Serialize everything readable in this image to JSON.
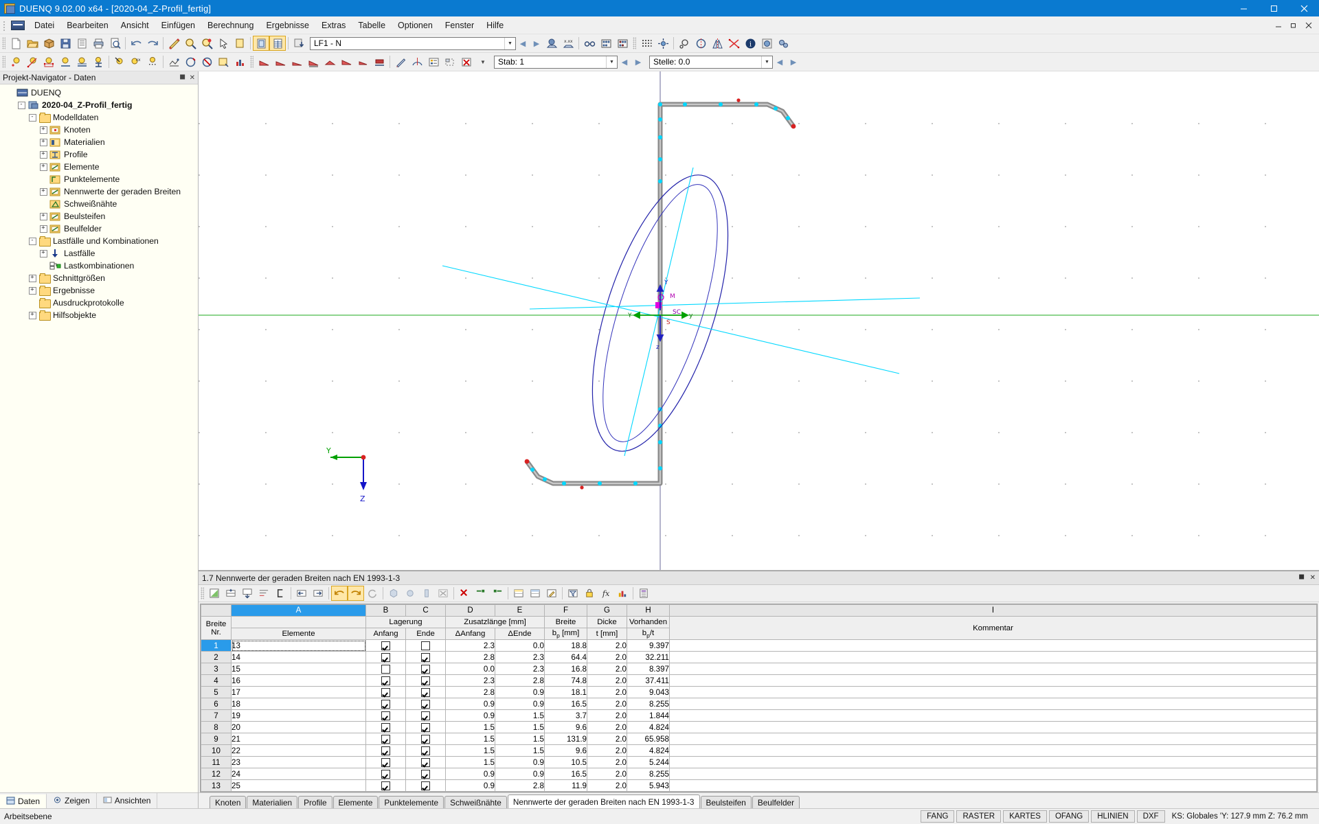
{
  "window": {
    "title": "DUENQ 9.02.00 x64 - [2020-04_Z-Profil_fertig]",
    "minimize": "–",
    "maximize": "❐",
    "close": "✕",
    "mdi_minimize": "–",
    "mdi_restore": "❐",
    "mdi_close": "✕"
  },
  "menubar": {
    "items": [
      {
        "label": "Datei"
      },
      {
        "label": "Bearbeiten"
      },
      {
        "label": "Ansicht"
      },
      {
        "label": "Einfügen"
      },
      {
        "label": "Berechnung"
      },
      {
        "label": "Ergebnisse"
      },
      {
        "label": "Extras"
      },
      {
        "label": "Tabelle"
      },
      {
        "label": "Optionen"
      },
      {
        "label": "Fenster"
      },
      {
        "label": "Hilfe"
      }
    ]
  },
  "toolbar1": {
    "loadcase_value": "LF1 - N",
    "icons": [
      "new-file-icon",
      "open-folder-icon",
      "package-icon",
      "save-icon",
      "clipboard-icon",
      "print-icon",
      "print-preview-icon",
      "undo-icon",
      "redo-icon",
      "edit-section-icon",
      "zoom-icon",
      "zoom-warning-icon",
      "select-pointer-icon",
      "copy-icon",
      "render-panel-icon",
      "table-panel-icon",
      "export-icon"
    ],
    "nav_prev": "◀",
    "nav_next": "▶",
    "icons2": [
      "view-point-icon",
      "scale-xx-icon",
      "glasses-icon",
      "abacus-icon",
      "abacus2-icon",
      "grid-icon",
      "snap-icon",
      "rotate-icon",
      "mirror-icon",
      "symmetry-icon",
      "intersect-icon",
      "info-icon",
      "settings-icon",
      "gears-icon"
    ]
  },
  "toolbar2": {
    "stab_label": "Stab: 1",
    "stelle_label": "Stelle: 0.0",
    "nav_prev": "◀",
    "nav_next": "▶",
    "icons": [
      "node-icon",
      "line-icon",
      "member-icon",
      "support-icon",
      "support2-icon",
      "section-icon",
      "load-icon",
      "load-xx-icon",
      "load-dist-icon",
      "mesh-icon",
      "rotate-red-icon",
      "cancel-icon",
      "panel-icon",
      "chart-icon",
      "arrow1-icon",
      "arrow2-icon",
      "arrow3-icon",
      "arrow4-icon",
      "arrow5-icon",
      "arrow6-icon",
      "arrow7-icon",
      "block-icon",
      "pen-icon",
      "compass-icon",
      "legend-icon",
      "frame-icon",
      "clear-x-icon"
    ]
  },
  "navigator": {
    "header": "Projekt-Navigator - Daten",
    "pin_icon": "❐",
    "close_icon": "✕",
    "tree": [
      {
        "label": "DUENQ",
        "indent": 0,
        "expander": "",
        "icon": "app-icon",
        "bold": false
      },
      {
        "label": "2020-04_Z-Profil_fertig",
        "indent": 1,
        "expander": "-",
        "icon": "model-icon",
        "bold": true
      },
      {
        "label": "Modelldaten",
        "indent": 2,
        "expander": "-",
        "icon": "folder-icon",
        "bold": false
      },
      {
        "label": "Knoten",
        "indent": 3,
        "expander": "+",
        "icon": "node-folder-icon",
        "bold": false
      },
      {
        "label": "Materialien",
        "indent": 3,
        "expander": "+",
        "icon": "material-folder-icon",
        "bold": false
      },
      {
        "label": "Profile",
        "indent": 3,
        "expander": "+",
        "icon": "profile-folder-icon",
        "bold": false
      },
      {
        "label": "Elemente",
        "indent": 3,
        "expander": "+",
        "icon": "element-folder-icon",
        "bold": false
      },
      {
        "label": "Punktelemente",
        "indent": 3,
        "expander": "",
        "icon": "point-folder-icon",
        "bold": false
      },
      {
        "label": "Nennwerte der geraden Breiten",
        "indent": 3,
        "expander": "+",
        "icon": "element-folder-icon",
        "bold": false
      },
      {
        "label": "Schweißnähte",
        "indent": 3,
        "expander": "",
        "icon": "weld-folder-icon",
        "bold": false
      },
      {
        "label": "Beulsteifen",
        "indent": 3,
        "expander": "+",
        "icon": "element-folder-icon",
        "bold": false
      },
      {
        "label": "Beulfelder",
        "indent": 3,
        "expander": "+",
        "icon": "element-folder-icon",
        "bold": false
      },
      {
        "label": "Lastfälle und Kombinationen",
        "indent": 2,
        "expander": "-",
        "icon": "folder-icon",
        "bold": false
      },
      {
        "label": "Lastfälle",
        "indent": 3,
        "expander": "+",
        "icon": "loadcase-icon",
        "bold": false
      },
      {
        "label": "Lastkombinationen",
        "indent": 3,
        "expander": "",
        "icon": "loadcombo-icon",
        "bold": false
      },
      {
        "label": "Schnittgrößen",
        "indent": 2,
        "expander": "+",
        "icon": "folder-icon",
        "bold": false
      },
      {
        "label": "Ergebnisse",
        "indent": 2,
        "expander": "+",
        "icon": "folder-icon",
        "bold": false
      },
      {
        "label": "Ausdruckprotokolle",
        "indent": 2,
        "expander": "",
        "icon": "folder-icon",
        "bold": false
      },
      {
        "label": "Hilfsobjekte",
        "indent": 2,
        "expander": "+",
        "icon": "folder-icon",
        "bold": false
      }
    ],
    "tabs": [
      {
        "label": "Daten",
        "icon": "data-icon",
        "selected": true
      },
      {
        "label": "Zeigen",
        "icon": "show-icon",
        "selected": false
      },
      {
        "label": "Ansichten",
        "icon": "views-icon",
        "selected": false
      }
    ]
  },
  "canvas": {
    "axis_y_label": "Y",
    "axis_z_label": "Z",
    "origin_y_label": "Y",
    "origin_z_label": "Z",
    "marker_m": "M",
    "marker_s": "S",
    "marker_sc": "SC"
  },
  "table": {
    "caption": "1.7 Nennwerte der geraden Breiten nach EN 1993-1-3",
    "pin_icon": "❐",
    "close_icon": "✕",
    "column_letters": [
      "A",
      "B",
      "C",
      "D",
      "E",
      "F",
      "G",
      "H",
      "I"
    ],
    "selected_column": "A",
    "groups": [
      {
        "label": "",
        "span": 1
      },
      {
        "label": "Lagerung",
        "span": 2
      },
      {
        "label": "Zusatzlänge [mm]",
        "span": 2
      },
      {
        "label": "Breite",
        "span": 1
      },
      {
        "label": "Dicke",
        "span": 1
      },
      {
        "label": "Vorhanden",
        "span": 1
      },
      {
        "label": "",
        "span": 1
      }
    ],
    "headers_row1": [
      "Breite",
      "",
      "Lagerung",
      "",
      "Zusatzlänge [mm]",
      "",
      "Breite",
      "Dicke",
      "Vorhanden",
      ""
    ],
    "headers": [
      {
        "top": "Breite",
        "bottom": "Nr."
      },
      {
        "top": "",
        "bottom": "Elemente"
      },
      {
        "top": "Lagerung",
        "bottom": "Anfang"
      },
      {
        "top": "",
        "bottom": "Ende"
      },
      {
        "top": "Zusatzlänge [mm]",
        "bottom": "ΔAnfang"
      },
      {
        "top": "",
        "bottom": "ΔEnde"
      },
      {
        "top": "Breite",
        "bottom": "b_p [mm]"
      },
      {
        "top": "Dicke",
        "bottom": "t [mm]"
      },
      {
        "top": "Vorhanden",
        "bottom": "b_p/t"
      },
      {
        "top": "",
        "bottom": "Kommentar"
      }
    ],
    "header_labels": {
      "breite_nr_top": "Breite",
      "breite_nr_bottom": "Nr.",
      "elemente": "Elemente",
      "lagerung": "Lagerung",
      "anfang": "Anfang",
      "ende": "Ende",
      "zusatzlaenge": "Zusatzlänge [mm]",
      "d_anfang": "ΔAnfang",
      "d_ende": "ΔEnde",
      "breite": "Breite",
      "bp_mm": "b",
      "bp_mm_sub": "p",
      "bp_mm_unit": " [mm]",
      "dicke": "Dicke",
      "t_mm": "t [mm]",
      "vorhanden": "Vorhanden",
      "bpt": "b",
      "bpt_sub": "p",
      "bpt_rest": "/t",
      "kommentar": "Kommentar"
    },
    "rows": [
      {
        "nr": "1",
        "elemente": "13",
        "anfang": true,
        "ende": false,
        "d_anfang": "2.3",
        "d_ende": "0.0",
        "bp": "18.8",
        "t": "2.0",
        "bpt": "9.397",
        "kommentar": ""
      },
      {
        "nr": "2",
        "elemente": "14",
        "anfang": true,
        "ende": true,
        "d_anfang": "2.8",
        "d_ende": "2.3",
        "bp": "64.4",
        "t": "2.0",
        "bpt": "32.211",
        "kommentar": ""
      },
      {
        "nr": "3",
        "elemente": "15",
        "anfang": false,
        "ende": true,
        "d_anfang": "0.0",
        "d_ende": "2.3",
        "bp": "16.8",
        "t": "2.0",
        "bpt": "8.397",
        "kommentar": ""
      },
      {
        "nr": "4",
        "elemente": "16",
        "anfang": true,
        "ende": true,
        "d_anfang": "2.3",
        "d_ende": "2.8",
        "bp": "74.8",
        "t": "2.0",
        "bpt": "37.411",
        "kommentar": ""
      },
      {
        "nr": "5",
        "elemente": "17",
        "anfang": true,
        "ende": true,
        "d_anfang": "2.8",
        "d_ende": "0.9",
        "bp": "18.1",
        "t": "2.0",
        "bpt": "9.043",
        "kommentar": ""
      },
      {
        "nr": "6",
        "elemente": "18",
        "anfang": true,
        "ende": true,
        "d_anfang": "0.9",
        "d_ende": "0.9",
        "bp": "16.5",
        "t": "2.0",
        "bpt": "8.255",
        "kommentar": ""
      },
      {
        "nr": "7",
        "elemente": "19",
        "anfang": true,
        "ende": true,
        "d_anfang": "0.9",
        "d_ende": "1.5",
        "bp": "3.7",
        "t": "2.0",
        "bpt": "1.844",
        "kommentar": ""
      },
      {
        "nr": "8",
        "elemente": "20",
        "anfang": true,
        "ende": true,
        "d_anfang": "1.5",
        "d_ende": "1.5",
        "bp": "9.6",
        "t": "2.0",
        "bpt": "4.824",
        "kommentar": ""
      },
      {
        "nr": "9",
        "elemente": "21",
        "anfang": true,
        "ende": true,
        "d_anfang": "1.5",
        "d_ende": "1.5",
        "bp": "131.9",
        "t": "2.0",
        "bpt": "65.958",
        "kommentar": ""
      },
      {
        "nr": "10",
        "elemente": "22",
        "anfang": true,
        "ende": true,
        "d_anfang": "1.5",
        "d_ende": "1.5",
        "bp": "9.6",
        "t": "2.0",
        "bpt": "4.824",
        "kommentar": ""
      },
      {
        "nr": "11",
        "elemente": "23",
        "anfang": true,
        "ende": true,
        "d_anfang": "1.5",
        "d_ende": "0.9",
        "bp": "10.5",
        "t": "2.0",
        "bpt": "5.244",
        "kommentar": ""
      },
      {
        "nr": "12",
        "elemente": "24",
        "anfang": true,
        "ende": true,
        "d_anfang": "0.9",
        "d_ende": "0.9",
        "bp": "16.5",
        "t": "2.0",
        "bpt": "8.255",
        "kommentar": ""
      },
      {
        "nr": "13",
        "elemente": "25",
        "anfang": true,
        "ende": true,
        "d_anfang": "0.9",
        "d_ende": "2.8",
        "bp": "11.9",
        "t": "2.0",
        "bpt": "5.943",
        "kommentar": ""
      }
    ],
    "tabs": [
      {
        "label": "Knoten",
        "selected": false
      },
      {
        "label": "Materialien",
        "selected": false
      },
      {
        "label": "Profile",
        "selected": false
      },
      {
        "label": "Elemente",
        "selected": false
      },
      {
        "label": "Punktelemente",
        "selected": false
      },
      {
        "label": "Schweißnähte",
        "selected": false
      },
      {
        "label": "Nennwerte der geraden Breiten nach EN 1993-1-3",
        "selected": true
      },
      {
        "label": "Beulsteifen",
        "selected": false
      },
      {
        "label": "Beulfelder",
        "selected": false
      }
    ]
  },
  "statusbar": {
    "left": "Arbeitsebene",
    "chips": [
      "FANG",
      "RASTER",
      "KARTES",
      "OFANG",
      "HLINIEN",
      "DXF"
    ],
    "ks": "KS: Globales  'Y:  127.9 mm    Z:  76.2 mm"
  },
  "colors": {
    "title_blue": "#0a7ad0",
    "accent_select": "#2a9bea",
    "nav_bg": "#fffff4",
    "toolbar_bg": "#f0f0f0"
  }
}
